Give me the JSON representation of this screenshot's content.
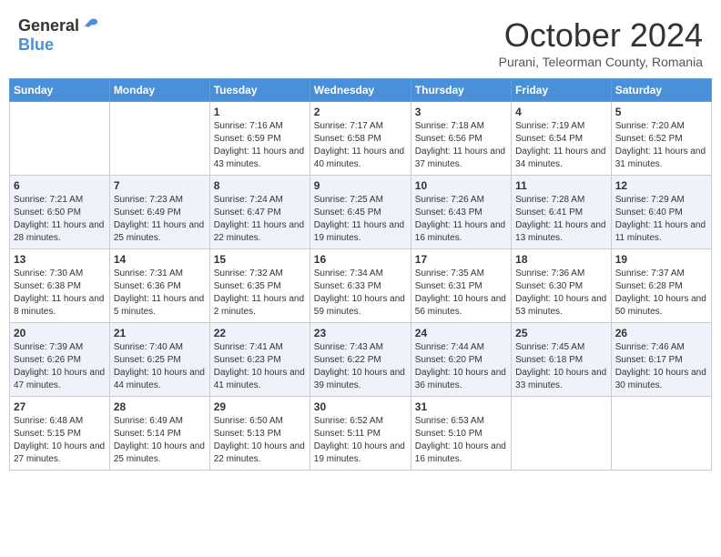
{
  "header": {
    "logo_general": "General",
    "logo_blue": "Blue",
    "month_title": "October 2024",
    "location": "Purani, Teleorman County, Romania"
  },
  "weekdays": [
    "Sunday",
    "Monday",
    "Tuesday",
    "Wednesday",
    "Thursday",
    "Friday",
    "Saturday"
  ],
  "weeks": [
    [
      {
        "day": "",
        "sunrise": "",
        "sunset": "",
        "daylight": ""
      },
      {
        "day": "",
        "sunrise": "",
        "sunset": "",
        "daylight": ""
      },
      {
        "day": "1",
        "sunrise": "Sunrise: 7:16 AM",
        "sunset": "Sunset: 6:59 PM",
        "daylight": "Daylight: 11 hours and 43 minutes."
      },
      {
        "day": "2",
        "sunrise": "Sunrise: 7:17 AM",
        "sunset": "Sunset: 6:58 PM",
        "daylight": "Daylight: 11 hours and 40 minutes."
      },
      {
        "day": "3",
        "sunrise": "Sunrise: 7:18 AM",
        "sunset": "Sunset: 6:56 PM",
        "daylight": "Daylight: 11 hours and 37 minutes."
      },
      {
        "day": "4",
        "sunrise": "Sunrise: 7:19 AM",
        "sunset": "Sunset: 6:54 PM",
        "daylight": "Daylight: 11 hours and 34 minutes."
      },
      {
        "day": "5",
        "sunrise": "Sunrise: 7:20 AM",
        "sunset": "Sunset: 6:52 PM",
        "daylight": "Daylight: 11 hours and 31 minutes."
      }
    ],
    [
      {
        "day": "6",
        "sunrise": "Sunrise: 7:21 AM",
        "sunset": "Sunset: 6:50 PM",
        "daylight": "Daylight: 11 hours and 28 minutes."
      },
      {
        "day": "7",
        "sunrise": "Sunrise: 7:23 AM",
        "sunset": "Sunset: 6:49 PM",
        "daylight": "Daylight: 11 hours and 25 minutes."
      },
      {
        "day": "8",
        "sunrise": "Sunrise: 7:24 AM",
        "sunset": "Sunset: 6:47 PM",
        "daylight": "Daylight: 11 hours and 22 minutes."
      },
      {
        "day": "9",
        "sunrise": "Sunrise: 7:25 AM",
        "sunset": "Sunset: 6:45 PM",
        "daylight": "Daylight: 11 hours and 19 minutes."
      },
      {
        "day": "10",
        "sunrise": "Sunrise: 7:26 AM",
        "sunset": "Sunset: 6:43 PM",
        "daylight": "Daylight: 11 hours and 16 minutes."
      },
      {
        "day": "11",
        "sunrise": "Sunrise: 7:28 AM",
        "sunset": "Sunset: 6:41 PM",
        "daylight": "Daylight: 11 hours and 13 minutes."
      },
      {
        "day": "12",
        "sunrise": "Sunrise: 7:29 AM",
        "sunset": "Sunset: 6:40 PM",
        "daylight": "Daylight: 11 hours and 11 minutes."
      }
    ],
    [
      {
        "day": "13",
        "sunrise": "Sunrise: 7:30 AM",
        "sunset": "Sunset: 6:38 PM",
        "daylight": "Daylight: 11 hours and 8 minutes."
      },
      {
        "day": "14",
        "sunrise": "Sunrise: 7:31 AM",
        "sunset": "Sunset: 6:36 PM",
        "daylight": "Daylight: 11 hours and 5 minutes."
      },
      {
        "day": "15",
        "sunrise": "Sunrise: 7:32 AM",
        "sunset": "Sunset: 6:35 PM",
        "daylight": "Daylight: 11 hours and 2 minutes."
      },
      {
        "day": "16",
        "sunrise": "Sunrise: 7:34 AM",
        "sunset": "Sunset: 6:33 PM",
        "daylight": "Daylight: 10 hours and 59 minutes."
      },
      {
        "day": "17",
        "sunrise": "Sunrise: 7:35 AM",
        "sunset": "Sunset: 6:31 PM",
        "daylight": "Daylight: 10 hours and 56 minutes."
      },
      {
        "day": "18",
        "sunrise": "Sunrise: 7:36 AM",
        "sunset": "Sunset: 6:30 PM",
        "daylight": "Daylight: 10 hours and 53 minutes."
      },
      {
        "day": "19",
        "sunrise": "Sunrise: 7:37 AM",
        "sunset": "Sunset: 6:28 PM",
        "daylight": "Daylight: 10 hours and 50 minutes."
      }
    ],
    [
      {
        "day": "20",
        "sunrise": "Sunrise: 7:39 AM",
        "sunset": "Sunset: 6:26 PM",
        "daylight": "Daylight: 10 hours and 47 minutes."
      },
      {
        "day": "21",
        "sunrise": "Sunrise: 7:40 AM",
        "sunset": "Sunset: 6:25 PM",
        "daylight": "Daylight: 10 hours and 44 minutes."
      },
      {
        "day": "22",
        "sunrise": "Sunrise: 7:41 AM",
        "sunset": "Sunset: 6:23 PM",
        "daylight": "Daylight: 10 hours and 41 minutes."
      },
      {
        "day": "23",
        "sunrise": "Sunrise: 7:43 AM",
        "sunset": "Sunset: 6:22 PM",
        "daylight": "Daylight: 10 hours and 39 minutes."
      },
      {
        "day": "24",
        "sunrise": "Sunrise: 7:44 AM",
        "sunset": "Sunset: 6:20 PM",
        "daylight": "Daylight: 10 hours and 36 minutes."
      },
      {
        "day": "25",
        "sunrise": "Sunrise: 7:45 AM",
        "sunset": "Sunset: 6:18 PM",
        "daylight": "Daylight: 10 hours and 33 minutes."
      },
      {
        "day": "26",
        "sunrise": "Sunrise: 7:46 AM",
        "sunset": "Sunset: 6:17 PM",
        "daylight": "Daylight: 10 hours and 30 minutes."
      }
    ],
    [
      {
        "day": "27",
        "sunrise": "Sunrise: 6:48 AM",
        "sunset": "Sunset: 5:15 PM",
        "daylight": "Daylight: 10 hours and 27 minutes."
      },
      {
        "day": "28",
        "sunrise": "Sunrise: 6:49 AM",
        "sunset": "Sunset: 5:14 PM",
        "daylight": "Daylight: 10 hours and 25 minutes."
      },
      {
        "day": "29",
        "sunrise": "Sunrise: 6:50 AM",
        "sunset": "Sunset: 5:13 PM",
        "daylight": "Daylight: 10 hours and 22 minutes."
      },
      {
        "day": "30",
        "sunrise": "Sunrise: 6:52 AM",
        "sunset": "Sunset: 5:11 PM",
        "daylight": "Daylight: 10 hours and 19 minutes."
      },
      {
        "day": "31",
        "sunrise": "Sunrise: 6:53 AM",
        "sunset": "Sunset: 5:10 PM",
        "daylight": "Daylight: 10 hours and 16 minutes."
      },
      {
        "day": "",
        "sunrise": "",
        "sunset": "",
        "daylight": ""
      },
      {
        "day": "",
        "sunrise": "",
        "sunset": "",
        "daylight": ""
      }
    ]
  ]
}
